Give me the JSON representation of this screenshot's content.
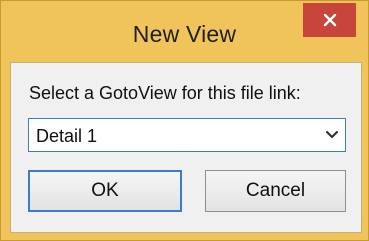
{
  "window": {
    "title": "New View",
    "close_icon": "close-icon"
  },
  "dialog": {
    "prompt": "Select a GotoView for this file link:",
    "select": {
      "value": "Detail 1",
      "icon": "chevron-down-icon"
    },
    "buttons": {
      "ok_label": "OK",
      "cancel_label": "Cancel"
    }
  },
  "colors": {
    "frame": "#f0c45a",
    "close_button": "#c8453a",
    "focus_border": "#3d7bd1",
    "client_background": "#f0f0f0"
  }
}
